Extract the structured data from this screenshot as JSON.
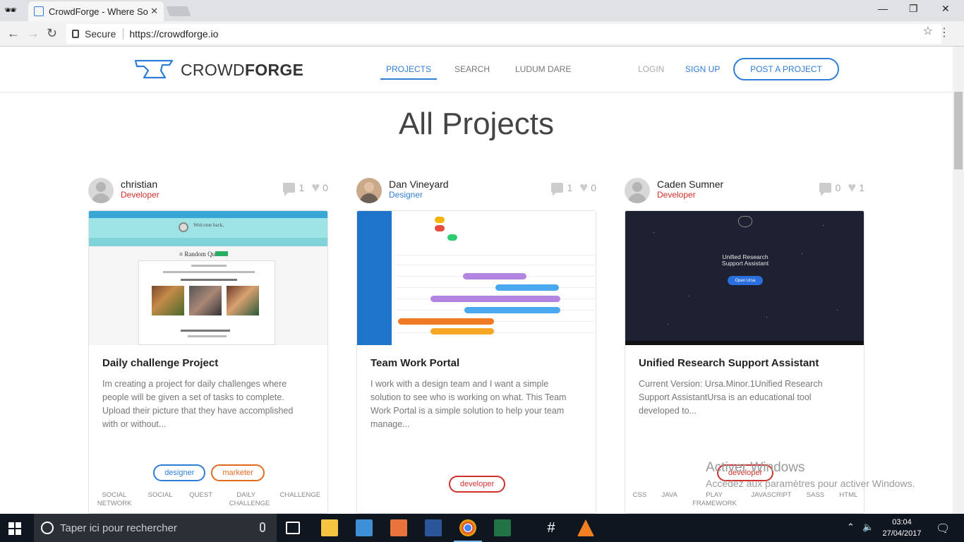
{
  "browser": {
    "tab_title": "CrowdForge - Where So",
    "tab_close": "✕",
    "secure_label": "Secure",
    "url": "https://crowdforge.io",
    "win_min": "—",
    "win_max": "❐",
    "win_close": "✕"
  },
  "site": {
    "logo_light": "CROWD",
    "logo_bold": "FORGE",
    "nav": [
      "PROJECTS",
      "SEARCH",
      "LUDUM DARE"
    ],
    "login": "LOGIN",
    "signup": "SIGN UP",
    "post_project": "POST A PROJECT",
    "page_title": "All Projects"
  },
  "cards": [
    {
      "user": "christian",
      "role": "Developer",
      "comments": "1",
      "likes": "0",
      "title": "Daily challenge Project",
      "description": "Im creating a project for daily challenges where people will be given a set of tasks to complete. Upload their picture that they have accomplished with or without...",
      "tags": [
        "designer",
        "marketer"
      ],
      "skills": [
        "SOCIAL NETWORK",
        "SOCIAL",
        "QUEST",
        "DAILY CHALLENGE",
        "CHALLENGE"
      ],
      "thumb": {
        "welcome": "Welcome back,",
        "random_quest": "≡ Random Quest -"
      }
    },
    {
      "user": "Dan Vineyard",
      "role": "Designer",
      "comments": "1",
      "likes": "0",
      "title": "Team Work Portal",
      "description": "I work with a design team and I want a simple solution to see who is working on what. This Team Work Portal is a simple solution to help your team manage...",
      "tags": [
        "developer"
      ],
      "skills": []
    },
    {
      "user": "Caden Sumner",
      "role": "Developer",
      "comments": "0",
      "likes": "1",
      "title": "Unified Research Support Assistant",
      "description": "Current Version: Ursa.Minor.1Unified Research Support AssistantUrsa is an educational tool developed to...",
      "tags": [
        "developer"
      ],
      "skills": [
        "CSS",
        "JAVA",
        "PLAY FRAMEWORK",
        "JAVASCRIPT",
        "SASS",
        "HTML"
      ],
      "thumb": {
        "line1": "Unified Research",
        "line2": "Support Assistant",
        "button": "Open Ursa"
      }
    }
  ],
  "watermark": {
    "line1": "Activer Windows",
    "line2": "Accédez aux paramètres pour activer Windows."
  },
  "taskbar": {
    "search_placeholder": "Taper ici pour rechercher",
    "time": "03:04",
    "date": "27/04/2017"
  },
  "colors": {
    "accent": "#2f7ed8",
    "developer": "#d0312d",
    "marketer": "#e36b20"
  }
}
